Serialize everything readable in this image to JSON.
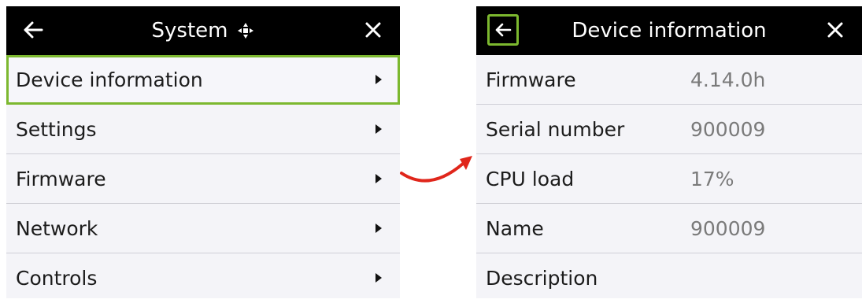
{
  "left": {
    "title": "System",
    "back_icon": "arrow-left-icon",
    "title_icon": "dpad-icon",
    "close_icon": "close-icon",
    "items": [
      {
        "label": "Device information",
        "selected": true
      },
      {
        "label": "Settings",
        "selected": false
      },
      {
        "label": "Firmware",
        "selected": false
      },
      {
        "label": "Network",
        "selected": false
      },
      {
        "label": "Controls",
        "selected": false
      }
    ]
  },
  "transition_icon": "curved-arrow-icon",
  "right": {
    "title": "Device information",
    "back_icon": "arrow-left-icon",
    "close_icon": "close-icon",
    "rows": [
      {
        "label": "Firmware",
        "value": "4.14.0h"
      },
      {
        "label": "Serial number",
        "value": "900009"
      },
      {
        "label": "CPU load",
        "value": "17%"
      },
      {
        "label": "Name",
        "value": "900009"
      },
      {
        "label": "Description",
        "value": ""
      }
    ]
  },
  "colors": {
    "header_bg": "#000000",
    "highlight": "#7cb82f",
    "arrow": "#e0261b",
    "panel_bg": "#f4f4f8"
  }
}
